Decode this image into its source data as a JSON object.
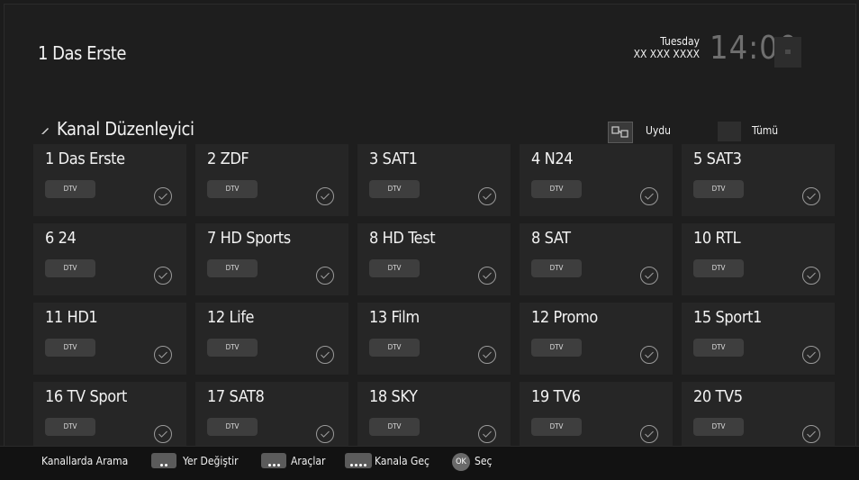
{
  "header": {
    "channel_title": "1 Das Erste",
    "day": "Tuesday",
    "date": "XX XXX XXXX",
    "time": "14:00"
  },
  "editor": {
    "title": "Kanal Düzenleyici",
    "filters": [
      {
        "label": "Uydu",
        "icon": "satellite-icon"
      },
      {
        "label": "Tümü",
        "icon": "all-channels-icon"
      }
    ]
  },
  "channels": [
    {
      "name": "1 Das Erste",
      "badge": "DTV"
    },
    {
      "name": "2 ZDF",
      "badge": "DTV"
    },
    {
      "name": "3 SAT1",
      "badge": "DTV"
    },
    {
      "name": "4 N24",
      "badge": "DTV"
    },
    {
      "name": "5 SAT3",
      "badge": "DTV"
    },
    {
      "name": "6 24",
      "badge": "DTV"
    },
    {
      "name": "7 HD Sports",
      "badge": "DTV"
    },
    {
      "name": "8 HD Test",
      "badge": "DTV"
    },
    {
      "name": "8 SAT",
      "badge": "DTV"
    },
    {
      "name": "10 RTL",
      "badge": "DTV"
    },
    {
      "name": "11 HD1",
      "badge": "DTV"
    },
    {
      "name": "12 Life",
      "badge": "DTV"
    },
    {
      "name": "13 Film",
      "badge": "DTV"
    },
    {
      "name": "12 Promo",
      "badge": "DTV"
    },
    {
      "name": "15 Sport1",
      "badge": "DTV"
    },
    {
      "name": "16 TV Sport",
      "badge": "DTV"
    },
    {
      "name": "17 SAT8",
      "badge": "DTV"
    },
    {
      "name": "18 SKY",
      "badge": "DTV"
    },
    {
      "name": "19 TV6",
      "badge": "DTV"
    },
    {
      "name": "20 TV5",
      "badge": "DTV"
    }
  ],
  "footer": {
    "search": "Kanallarda Arama",
    "swap": "Yer Değiştir",
    "tools": "Araçlar",
    "goto": "Kanala Geç",
    "ok_label": "OK",
    "select": "Seç"
  }
}
